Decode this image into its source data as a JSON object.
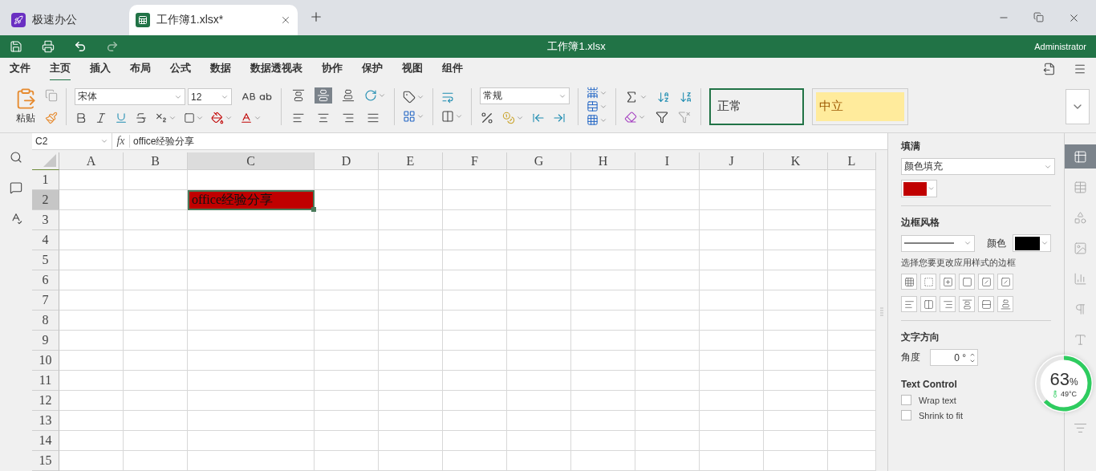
{
  "tabs": [
    {
      "label": "极速办公",
      "kind": "app",
      "selected": false
    },
    {
      "label": "工作簿1.xlsx*",
      "kind": "doc",
      "selected": true
    }
  ],
  "title_bar": {
    "title": "工作簿1.xlsx",
    "user": "Administrator"
  },
  "menu": [
    {
      "label": "文件",
      "selected": false
    },
    {
      "label": "主页",
      "selected": true
    },
    {
      "label": "插入",
      "selected": false
    },
    {
      "label": "布局",
      "selected": false
    },
    {
      "label": "公式",
      "selected": false
    },
    {
      "label": "数据",
      "selected": false
    },
    {
      "label": "数据透视表",
      "selected": false
    },
    {
      "label": "协作",
      "selected": false
    },
    {
      "label": "保护",
      "selected": false
    },
    {
      "label": "视图",
      "selected": false
    },
    {
      "label": "组件",
      "selected": false
    }
  ],
  "ribbon": {
    "paste_label": "粘贴",
    "font_name": "宋体",
    "font_size": "12",
    "number_format": "常规",
    "alignments": [
      {
        "kind": "top",
        "selected": false
      },
      {
        "kind": "middle",
        "selected": true
      },
      {
        "kind": "bottom",
        "selected": false
      },
      {
        "kind": "left",
        "selected": false
      },
      {
        "kind": "center",
        "selected": false
      },
      {
        "kind": "right",
        "selected": false
      },
      {
        "kind": "justify",
        "selected": false
      }
    ],
    "styles": [
      {
        "label": "正常",
        "kind": "normal",
        "selected": true
      },
      {
        "label": "中立",
        "kind": "neutral",
        "selected": false
      }
    ]
  },
  "formula_bar": {
    "cell_ref": "C2",
    "fx": "fx",
    "value": "office经验分享"
  },
  "sheet": {
    "columns": [
      {
        "label": "A",
        "selected": false
      },
      {
        "label": "B",
        "selected": false
      },
      {
        "label": "C",
        "selected": true
      },
      {
        "label": "D",
        "selected": false
      },
      {
        "label": "E",
        "selected": false
      },
      {
        "label": "F",
        "selected": false
      },
      {
        "label": "G",
        "selected": false
      },
      {
        "label": "H",
        "selected": false
      },
      {
        "label": "I",
        "selected": false
      },
      {
        "label": "J",
        "selected": false
      },
      {
        "label": "K",
        "selected": false
      },
      {
        "label": "L",
        "selected": false
      }
    ],
    "rows": [
      {
        "label": "1",
        "selected": false
      },
      {
        "label": "2",
        "selected": true
      },
      {
        "label": "3",
        "selected": false
      },
      {
        "label": "4",
        "selected": false
      },
      {
        "label": "5",
        "selected": false
      },
      {
        "label": "6",
        "selected": false
      },
      {
        "label": "7",
        "selected": false
      },
      {
        "label": "8",
        "selected": false
      },
      {
        "label": "9",
        "selected": false
      },
      {
        "label": "10",
        "selected": false
      },
      {
        "label": "11",
        "selected": false
      },
      {
        "label": "12",
        "selected": false
      },
      {
        "label": "13",
        "selected": false
      },
      {
        "label": "14",
        "selected": false
      },
      {
        "label": "15",
        "selected": false
      }
    ],
    "active_cell": {
      "value": "office经验分享",
      "color": "#c00000"
    }
  },
  "panel": {
    "fill": {
      "title": "填满",
      "type": "颜色填充",
      "color": "#c00000"
    },
    "border": {
      "title": "边框风格",
      "color_label": "颜色",
      "color": "#000000",
      "hint": "选择您要更改应用样式的边框"
    },
    "text_direction": {
      "title": "文字方向",
      "angle_label": "角度",
      "angle": "0 °"
    },
    "text_control": {
      "title": "Text Control",
      "options": [
        {
          "label": "Wrap text",
          "checked": false
        },
        {
          "label": "Shrink to fit",
          "checked": false
        }
      ]
    }
  },
  "side_tabs": [
    {
      "kind": "cell",
      "selected": true
    },
    {
      "kind": "table",
      "selected": false
    },
    {
      "kind": "shape",
      "selected": false
    },
    {
      "kind": "image",
      "selected": false
    },
    {
      "kind": "chart",
      "selected": false
    },
    {
      "kind": "paragraph",
      "selected": false
    },
    {
      "kind": "text",
      "selected": false
    },
    {
      "kind": "filter",
      "selected": false
    }
  ],
  "monitor": {
    "value": "63",
    "unit": "%",
    "temperature": "49°C"
  }
}
